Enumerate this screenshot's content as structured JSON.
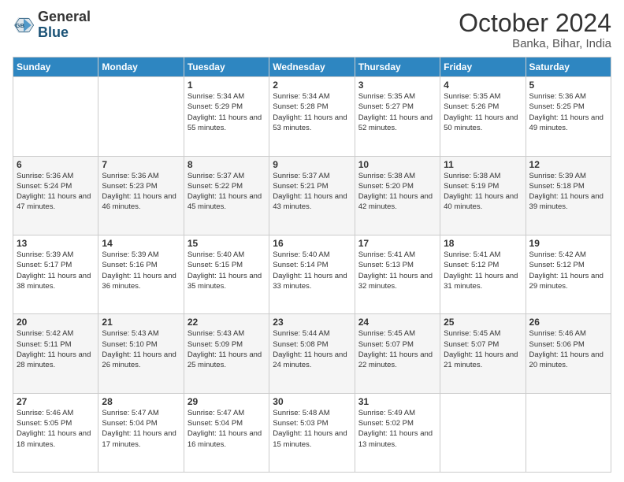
{
  "logo": {
    "general": "General",
    "blue": "Blue"
  },
  "header": {
    "month": "October 2024",
    "location": "Banka, Bihar, India"
  },
  "weekdays": [
    "Sunday",
    "Monday",
    "Tuesday",
    "Wednesday",
    "Thursday",
    "Friday",
    "Saturday"
  ],
  "weeks": [
    [
      {
        "day": "",
        "info": ""
      },
      {
        "day": "",
        "info": ""
      },
      {
        "day": "1",
        "sunrise": "5:34 AM",
        "sunset": "5:29 PM",
        "daylight": "11 hours and 55 minutes."
      },
      {
        "day": "2",
        "sunrise": "5:34 AM",
        "sunset": "5:28 PM",
        "daylight": "11 hours and 53 minutes."
      },
      {
        "day": "3",
        "sunrise": "5:35 AM",
        "sunset": "5:27 PM",
        "daylight": "11 hours and 52 minutes."
      },
      {
        "day": "4",
        "sunrise": "5:35 AM",
        "sunset": "5:26 PM",
        "daylight": "11 hours and 50 minutes."
      },
      {
        "day": "5",
        "sunrise": "5:36 AM",
        "sunset": "5:25 PM",
        "daylight": "11 hours and 49 minutes."
      }
    ],
    [
      {
        "day": "6",
        "sunrise": "5:36 AM",
        "sunset": "5:24 PM",
        "daylight": "11 hours and 47 minutes."
      },
      {
        "day": "7",
        "sunrise": "5:36 AM",
        "sunset": "5:23 PM",
        "daylight": "11 hours and 46 minutes."
      },
      {
        "day": "8",
        "sunrise": "5:37 AM",
        "sunset": "5:22 PM",
        "daylight": "11 hours and 45 minutes."
      },
      {
        "day": "9",
        "sunrise": "5:37 AM",
        "sunset": "5:21 PM",
        "daylight": "11 hours and 43 minutes."
      },
      {
        "day": "10",
        "sunrise": "5:38 AM",
        "sunset": "5:20 PM",
        "daylight": "11 hours and 42 minutes."
      },
      {
        "day": "11",
        "sunrise": "5:38 AM",
        "sunset": "5:19 PM",
        "daylight": "11 hours and 40 minutes."
      },
      {
        "day": "12",
        "sunrise": "5:39 AM",
        "sunset": "5:18 PM",
        "daylight": "11 hours and 39 minutes."
      }
    ],
    [
      {
        "day": "13",
        "sunrise": "5:39 AM",
        "sunset": "5:17 PM",
        "daylight": "11 hours and 38 minutes."
      },
      {
        "day": "14",
        "sunrise": "5:39 AM",
        "sunset": "5:16 PM",
        "daylight": "11 hours and 36 minutes."
      },
      {
        "day": "15",
        "sunrise": "5:40 AM",
        "sunset": "5:15 PM",
        "daylight": "11 hours and 35 minutes."
      },
      {
        "day": "16",
        "sunrise": "5:40 AM",
        "sunset": "5:14 PM",
        "daylight": "11 hours and 33 minutes."
      },
      {
        "day": "17",
        "sunrise": "5:41 AM",
        "sunset": "5:13 PM",
        "daylight": "11 hours and 32 minutes."
      },
      {
        "day": "18",
        "sunrise": "5:41 AM",
        "sunset": "5:12 PM",
        "daylight": "11 hours and 31 minutes."
      },
      {
        "day": "19",
        "sunrise": "5:42 AM",
        "sunset": "5:12 PM",
        "daylight": "11 hours and 29 minutes."
      }
    ],
    [
      {
        "day": "20",
        "sunrise": "5:42 AM",
        "sunset": "5:11 PM",
        "daylight": "11 hours and 28 minutes."
      },
      {
        "day": "21",
        "sunrise": "5:43 AM",
        "sunset": "5:10 PM",
        "daylight": "11 hours and 26 minutes."
      },
      {
        "day": "22",
        "sunrise": "5:43 AM",
        "sunset": "5:09 PM",
        "daylight": "11 hours and 25 minutes."
      },
      {
        "day": "23",
        "sunrise": "5:44 AM",
        "sunset": "5:08 PM",
        "daylight": "11 hours and 24 minutes."
      },
      {
        "day": "24",
        "sunrise": "5:45 AM",
        "sunset": "5:07 PM",
        "daylight": "11 hours and 22 minutes."
      },
      {
        "day": "25",
        "sunrise": "5:45 AM",
        "sunset": "5:07 PM",
        "daylight": "11 hours and 21 minutes."
      },
      {
        "day": "26",
        "sunrise": "5:46 AM",
        "sunset": "5:06 PM",
        "daylight": "11 hours and 20 minutes."
      }
    ],
    [
      {
        "day": "27",
        "sunrise": "5:46 AM",
        "sunset": "5:05 PM",
        "daylight": "11 hours and 18 minutes."
      },
      {
        "day": "28",
        "sunrise": "5:47 AM",
        "sunset": "5:04 PM",
        "daylight": "11 hours and 17 minutes."
      },
      {
        "day": "29",
        "sunrise": "5:47 AM",
        "sunset": "5:04 PM",
        "daylight": "11 hours and 16 minutes."
      },
      {
        "day": "30",
        "sunrise": "5:48 AM",
        "sunset": "5:03 PM",
        "daylight": "11 hours and 15 minutes."
      },
      {
        "day": "31",
        "sunrise": "5:49 AM",
        "sunset": "5:02 PM",
        "daylight": "11 hours and 13 minutes."
      },
      {
        "day": "",
        "info": ""
      },
      {
        "day": "",
        "info": ""
      }
    ]
  ]
}
